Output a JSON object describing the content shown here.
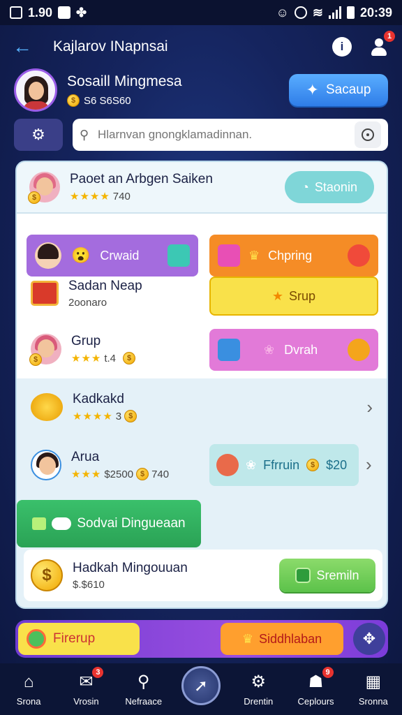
{
  "status": {
    "time_left": "1.90",
    "time_right": "20:39"
  },
  "appbar": {
    "title": "Kajlarov INapnsai"
  },
  "profile": {
    "name": "Sosaill Mingmesa",
    "coins": "S6 S6S60",
    "setup_label": "Sacaup"
  },
  "search": {
    "placeholder": "Hlarnvan gnongklamadinnan."
  },
  "hero": {
    "title": "Paoet an Arbgen Saiken",
    "rating": "740",
    "action_label": "Staonin"
  },
  "tiles": {
    "crwaid": "Crwaid",
    "chpring": "Chpring",
    "srup": "Srup",
    "dvrah": "Dvrah"
  },
  "list": [
    {
      "title": "Sadan Neap",
      "sub": "2oonaro"
    },
    {
      "title": "Grup",
      "sub": "t.4"
    },
    {
      "title": "Kadkakd",
      "sub": "3"
    },
    {
      "title": "Arua",
      "sub": "$2500",
      "sub2": "740"
    }
  ],
  "ffrrun": {
    "label": "Ffrruin",
    "value": "$20"
  },
  "sandbox": {
    "label": "Sodvai  Dingueaan"
  },
  "income": {
    "title": "Hadkah Mingouuan",
    "sub": "$.$610",
    "action_label": "Sremiln"
  },
  "strip": {
    "left_label": "Firerup",
    "right_label": "Siddhlaban"
  },
  "nav": [
    {
      "label": "Srona",
      "icon": "home-icon"
    },
    {
      "label": "Vrosin",
      "icon": "mail-icon",
      "badge": "3"
    },
    {
      "label": "Nefraace",
      "icon": "search-icon"
    },
    {
      "label": "",
      "icon": "compass-icon"
    },
    {
      "label": "Drentin",
      "icon": "gear-icon"
    },
    {
      "label": "Ceplours",
      "icon": "people-icon",
      "badge": "9"
    },
    {
      "label": "Sronna",
      "icon": "grid-icon"
    }
  ],
  "colors": {
    "accent": "#2f7de8",
    "panel": "#e4f1f8",
    "green": "#3ac06b"
  }
}
